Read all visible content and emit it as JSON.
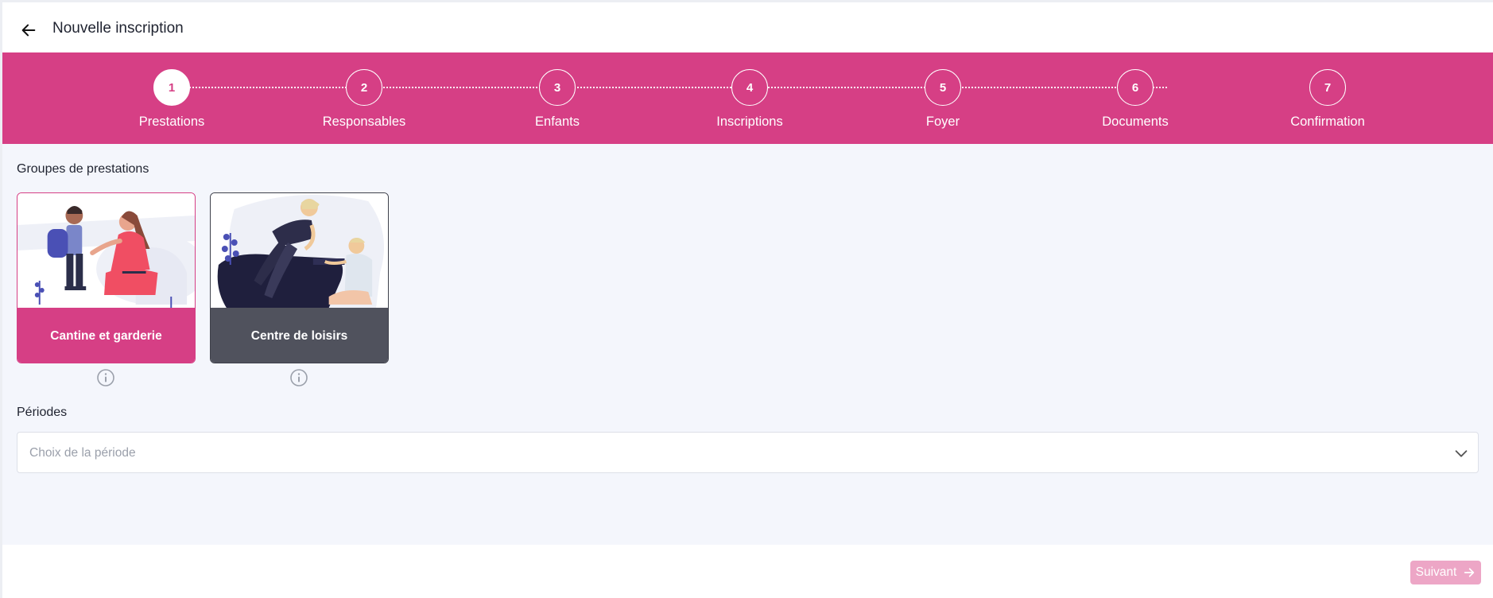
{
  "header": {
    "title": "Nouvelle inscription",
    "back_icon": "arrow-left-icon"
  },
  "stepper": {
    "active": 1,
    "steps": [
      {
        "number": "1",
        "label": "Prestations"
      },
      {
        "number": "2",
        "label": "Responsables"
      },
      {
        "number": "3",
        "label": "Enfants"
      },
      {
        "number": "4",
        "label": "Inscriptions"
      },
      {
        "number": "5",
        "label": "Foyer"
      },
      {
        "number": "6",
        "label": "Documents"
      },
      {
        "number": "7",
        "label": "Confirmation"
      }
    ]
  },
  "groups": {
    "title": "Groupes de prestations",
    "cards": [
      {
        "label": "Cantine et garderie",
        "selected": true
      },
      {
        "label": "Centre de loisirs",
        "selected": false
      }
    ]
  },
  "periods": {
    "title": "Périodes",
    "placeholder": "Choix de la période"
  },
  "footer": {
    "next_label": "Suivant"
  },
  "colors": {
    "accent": "#d63f85",
    "dark_card": "#50525d",
    "disabled_button": "#eda6c6",
    "background": "#f4f6fc"
  }
}
